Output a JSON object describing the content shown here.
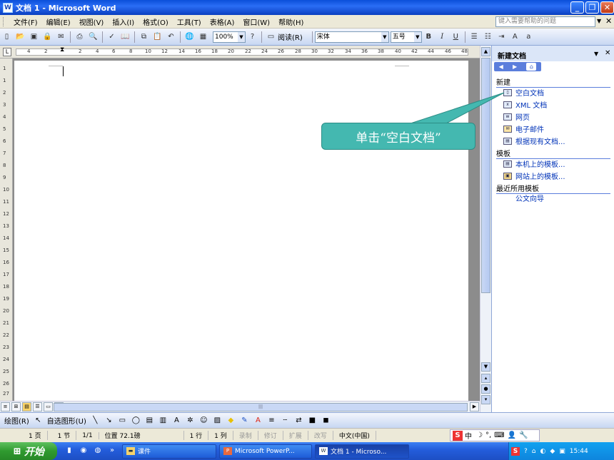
{
  "window": {
    "title": "文档 1 - Microsoft Word",
    "min": "_",
    "restore": "❐",
    "close": "✕"
  },
  "menu": {
    "items": [
      "文件(F)",
      "编辑(E)",
      "视图(V)",
      "插入(I)",
      "格式(O)",
      "工具(T)",
      "表格(A)",
      "窗口(W)",
      "帮助(H)"
    ],
    "ask_placeholder": "键入需要帮助的问题"
  },
  "toolbar": {
    "zoom": "100%",
    "read_label": "阅读(R)",
    "font": "宋体",
    "size": "五号",
    "bold": "B",
    "italic": "I",
    "underline": "U"
  },
  "ruler": {
    "h_numbers": [
      "4",
      "2",
      "2",
      "4",
      "6",
      "8",
      "10",
      "12",
      "14",
      "16",
      "18",
      "20",
      "22",
      "24",
      "26",
      "28",
      "30",
      "32",
      "34",
      "36",
      "38",
      "40",
      "42",
      "44",
      "46",
      "48"
    ],
    "v_numbers": [
      "1",
      "1",
      "2",
      "3",
      "4",
      "5",
      "6",
      "7",
      "8",
      "9",
      "10",
      "11",
      "12",
      "13",
      "14",
      "15",
      "16",
      "17",
      "18",
      "19",
      "20",
      "21",
      "22",
      "23",
      "24",
      "25",
      "26",
      "27"
    ]
  },
  "taskpane": {
    "title": "新建文档",
    "sections": [
      {
        "label": "新建",
        "links": [
          "空白文档",
          "XML 文档",
          "网页",
          "电子邮件",
          "根据现有文档..."
        ]
      },
      {
        "label": "模板",
        "links": [
          "本机上的模板...",
          "网站上的模板..."
        ]
      },
      {
        "label": "最近所用模板",
        "links": [
          "公文向导"
        ]
      }
    ]
  },
  "callout": {
    "text": "单击“空白文档”"
  },
  "drawbar": {
    "draw_label": "绘图(R)",
    "autoshape_label": "自选图形(U)"
  },
  "status": {
    "page": "1 页",
    "section": "1 节",
    "pages": "1/1",
    "position": "位置 72.1磅",
    "line": "1 行",
    "column": "1 列",
    "rec": "录制",
    "trk": "修订",
    "ext": "扩展",
    "ovr": "改写",
    "language": "中文(中国)",
    "ime_label": "中"
  },
  "taskbar": {
    "start": "开始",
    "tasks": [
      "课件",
      "Microsoft PowerP...",
      "文档 1 - Microso..."
    ],
    "clock": "15:44"
  },
  "colors": {
    "callout": "#44b8b0",
    "titlebar": "#0a4fd9",
    "taskbar": "#245edc",
    "start": "#2f9a2f",
    "link": "#0033b8"
  }
}
